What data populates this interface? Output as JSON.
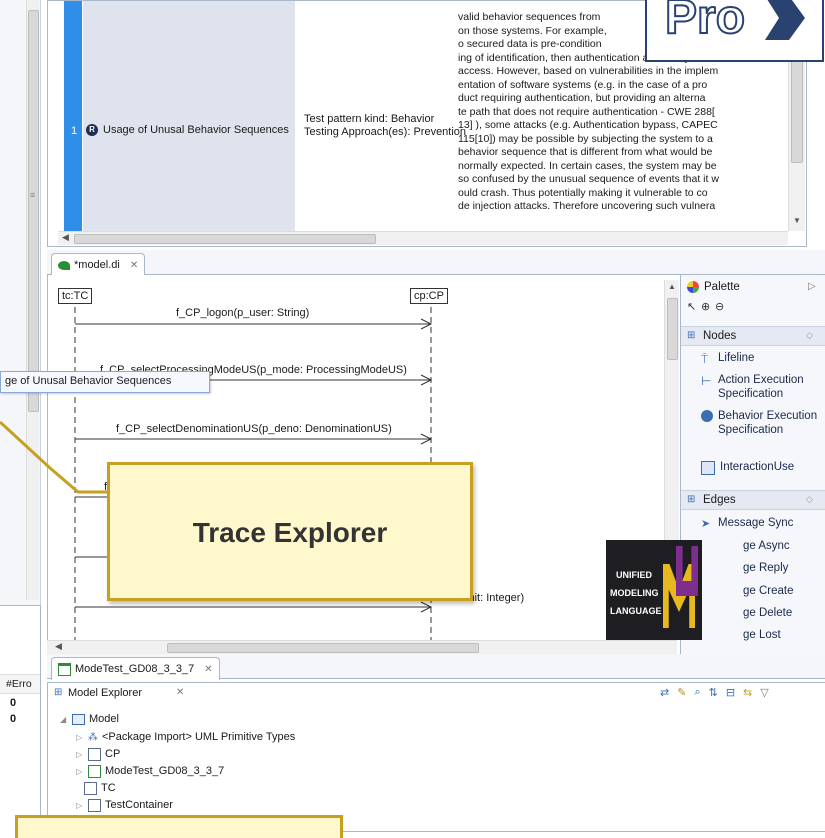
{
  "table": {
    "row_number": "1",
    "row_name": "Usage of Unusal Behavior Sequences",
    "pattern_kind": "Test pattern kind: Behavior",
    "testing_approach": "Testing Approach(es): Prevention",
    "description_lines": [
      "valid behavior sequences from",
      "on those systems. For example,",
      "o secured data is pre-condition",
      "ing of identification, then authentication and finally",
      "access. However, based on vulnerabilities in the implem",
      "entation of software systems (e.g. in the case of a pro",
      "duct requiring authentication, but providing an alterna",
      "te path that does not require authentication - CWE 288[",
      "13] ), some attacks (e.g. Authentication bypass, CAPEC",
      "115[10]) may be possible by subjecting the system to a",
      "behavior sequence that is different from what would be",
      "normally expected. In certain cases, the system may be",
      "so confused by the unusual sequence of events that it w",
      "ould crash. Thus potentially making it vulnerable to co",
      "de injection attacks. Therefore uncovering such vulnera"
    ]
  },
  "diagram_tab": {
    "label": "*model.di"
  },
  "diagram": {
    "lifeline_left": "tc:TC",
    "lifeline_right": "cp:CP",
    "messages": [
      "f_CP_logon(p_user: String)",
      "f_CP_selectProcessingModeUS(p_mode: ProcessingModeUS)",
      "f_CP_selectDenominationUS(p_deno: DenominationUS)",
      "f",
      "imit: Integer)"
    ],
    "tooltip": "ge of Unusal Behavior Sequences"
  },
  "palette": {
    "title": "Palette",
    "nodes_header": "Nodes",
    "nodes": [
      "Lifeline",
      "Action Execution Specification",
      "Behavior Execution Specification",
      "InteractionUse"
    ],
    "edges_header": "Edges",
    "edges": [
      "Message Sync",
      "ge Async",
      "ge Reply",
      "ge Create",
      "ge Delete",
      "ge Lost"
    ]
  },
  "modetest_tab": {
    "label": "ModeTest_GD08_3_3_7"
  },
  "model_explorer": {
    "tab_label": "Model Explorer",
    "root": "Model",
    "items": [
      "<Package Import> UML Primitive Types",
      "CP",
      "ModeTest_GD08_3_3_7",
      "TC",
      "TestContainer"
    ]
  },
  "left_table": {
    "header": "#Erro",
    "values": [
      "0",
      "0"
    ]
  },
  "callout_trace": {
    "label": "Trace Explorer"
  },
  "uml_logo": {
    "line1": "UNIFIED",
    "line2": "MODELING",
    "line3": "LANGUAGE"
  },
  "logo_top": {
    "text": "Pro"
  },
  "colors": {
    "accent_blue": "#2f8fe8",
    "row_bg": "#dfe3ee",
    "callout_border": "#c8a020",
    "callout_bg": "#fff8cc"
  }
}
